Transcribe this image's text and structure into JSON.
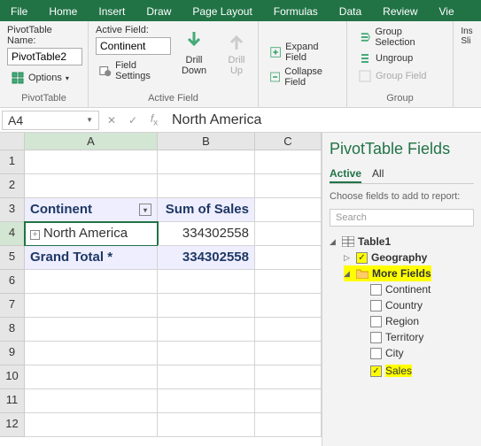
{
  "ribbon": {
    "tabs": [
      "File",
      "Home",
      "Insert",
      "Draw",
      "Page Layout",
      "Formulas",
      "Data",
      "Review",
      "Vie"
    ],
    "activeTab": "Home",
    "pivotTableName": {
      "label": "PivotTable Name:",
      "value": "PivotTable2"
    },
    "options": "Options",
    "activeField": {
      "label": "Active Field:",
      "value": "Continent"
    },
    "fieldSettings": "Field Settings",
    "drillDown": "Drill Down",
    "drillUp": "Drill Up",
    "expandField": "Expand Field",
    "collapseField": "Collapse Field",
    "groupSelection": "Group Selection",
    "ungroup": "Ungroup",
    "groupField": "Group Field",
    "insertSlicer": "Ins Sli",
    "groupLabels": {
      "pivot": "PivotTable",
      "active": "Active Field",
      "group": "Group"
    }
  },
  "formulaBar": {
    "nameBox": "A4",
    "value": "North America"
  },
  "sheet": {
    "columns": [
      "A",
      "B",
      "C"
    ],
    "rows": [
      1,
      2,
      3,
      4,
      5,
      6,
      7,
      8,
      9,
      10,
      11,
      12
    ],
    "data": {
      "A3": "Continent",
      "B3": "Sum of Sales",
      "A4": "North America",
      "B4": "334302558",
      "A5": "Grand Total *",
      "B5": "334302558"
    }
  },
  "fieldPane": {
    "title": "PivotTable Fields",
    "tabs": {
      "active": "Active",
      "all": "All"
    },
    "hint": "Choose fields to add to report:",
    "search": "Search",
    "tableName": "Table1",
    "geography": "Geography",
    "moreFields": "More Fields",
    "fields": [
      {
        "name": "Continent",
        "checked": false
      },
      {
        "name": "Country",
        "checked": false
      },
      {
        "name": "Region",
        "checked": false
      },
      {
        "name": "Territory",
        "checked": false
      },
      {
        "name": "City",
        "checked": false
      },
      {
        "name": "Sales",
        "checked": true,
        "hl": true
      }
    ]
  }
}
